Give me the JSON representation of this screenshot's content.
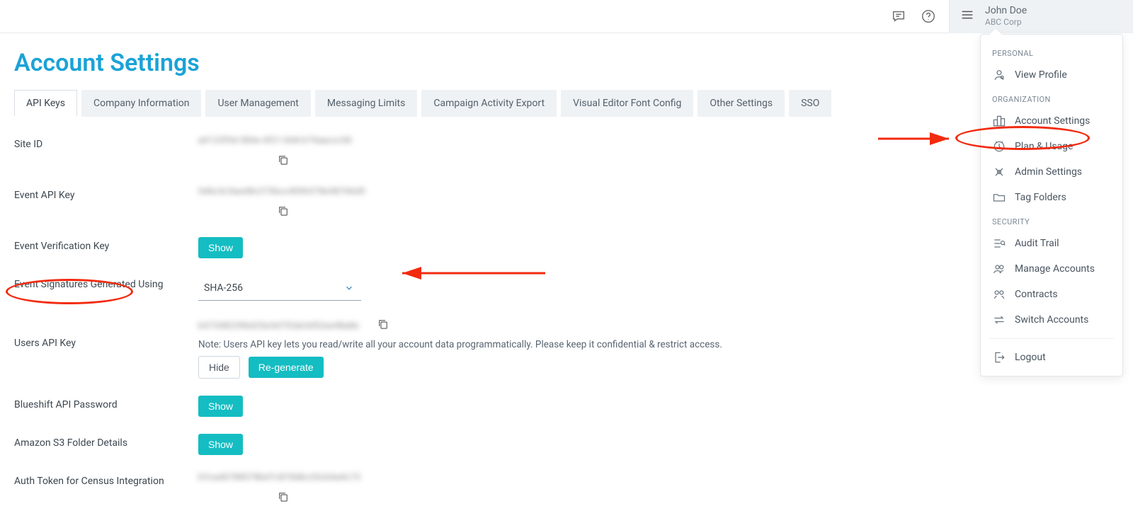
{
  "topbar": {
    "user_name": "John Doe",
    "user_org": "ABC Corp"
  },
  "dropdown": {
    "section_personal": "PERSONAL",
    "view_profile": "View Profile",
    "section_org": "ORGANIZATION",
    "account_settings": "Account Settings",
    "plan_usage": "Plan & Usage",
    "admin_settings": "Admin Settings",
    "tag_folders": "Tag Folders",
    "section_security": "SECURITY",
    "audit_trail": "Audit Trail",
    "manage_accounts": "Manage Accounts",
    "contracts": "Contracts",
    "switch_accounts": "Switch Accounts",
    "logout": "Logout"
  },
  "page": {
    "title": "Account Settings"
  },
  "tabs": {
    "api_keys": "API Keys",
    "company_info": "Company Information",
    "user_mgmt": "User Management",
    "messaging_limits": "Messaging Limits",
    "campaign_export": "Campaign Activity Export",
    "visual_editor": "Visual Editor Font Config",
    "other": "Other Settings",
    "sso": "SSO"
  },
  "rows": {
    "site_id_label": "Site ID",
    "site_id_value": "a0123f9d-584e-4f21-bh8-k79aaccc50",
    "event_api_label": "Event API Key",
    "event_api_value": "5d6c3c5aed8c275bcc4096378e58766d9",
    "event_verif_label": "Event Verification Key",
    "event_sig_label": "Event Signatures Generated Using",
    "event_sig_value": "SHA-256",
    "users_api_label": "Users API Key",
    "users_api_value": "b47348239bd25e3d7f2de3d52ee48a8e",
    "users_api_note": "Note: Users API key lets you read/write all your account data programmatically. Please keep it confidential & restrict access.",
    "blueshift_pw_label": "Blueshift API Password",
    "s3_label": "Amazon S3 Folder Details",
    "auth_token_label": "Auth Token for Census Integration",
    "auth_token_value": "bYcad0788578bd7c878dbc33cb4a4c73"
  },
  "buttons": {
    "show": "Show",
    "hide": "Hide",
    "regenerate": "Re-generate"
  }
}
